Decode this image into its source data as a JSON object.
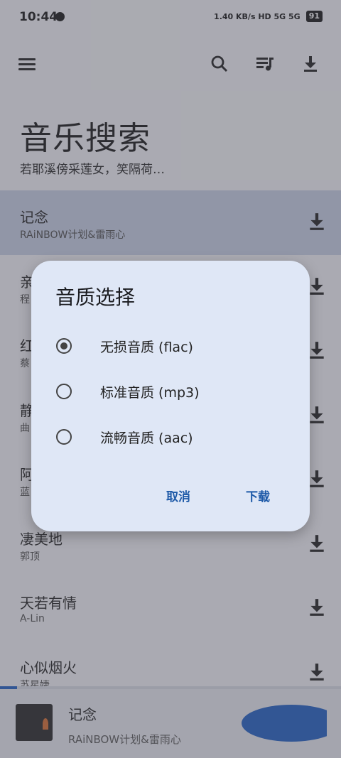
{
  "status_bar": {
    "time": "10:44",
    "indicators": "1.40 KB/s  HD  5G  5G",
    "battery": "91"
  },
  "toolbar": {
    "menu_icon": "hamburger-icon",
    "search_icon": "search-icon",
    "queue_icon": "playlist-icon",
    "download_icon": "download-icon"
  },
  "page": {
    "title": "音乐搜索",
    "subtitle": "若耶溪傍采莲女，笑隔荷…"
  },
  "songs": [
    {
      "title": "记念",
      "artist": "RAiNBOW计划&雷雨心",
      "selected": true
    },
    {
      "title": "亲",
      "artist": "程"
    },
    {
      "title": "红",
      "artist": "蔡"
    },
    {
      "title": "静",
      "artist": "曲"
    },
    {
      "title": "阿",
      "artist": "蓝"
    },
    {
      "title": "凄美地",
      "artist": "郭顶"
    },
    {
      "title": "天若有情",
      "artist": "A-Lin"
    },
    {
      "title": "心似烟火",
      "artist": "苏星婕"
    }
  ],
  "player": {
    "song": "记念",
    "artist": "RAiNBOW计划&雷雨心",
    "progress": 0.05
  },
  "dialog": {
    "title": "音质选择",
    "options": [
      {
        "label": "无损音质 (flac)",
        "checked": true
      },
      {
        "label": "标准音质 (mp3)",
        "checked": false
      },
      {
        "label": "流畅音质 (aac)",
        "checked": false
      }
    ],
    "cancel": "取消",
    "confirm": "下载"
  },
  "colors": {
    "accent": "#1e5aa8",
    "selected_row": "#c7d0e6",
    "dialog_bg": "#dfe7f6"
  }
}
